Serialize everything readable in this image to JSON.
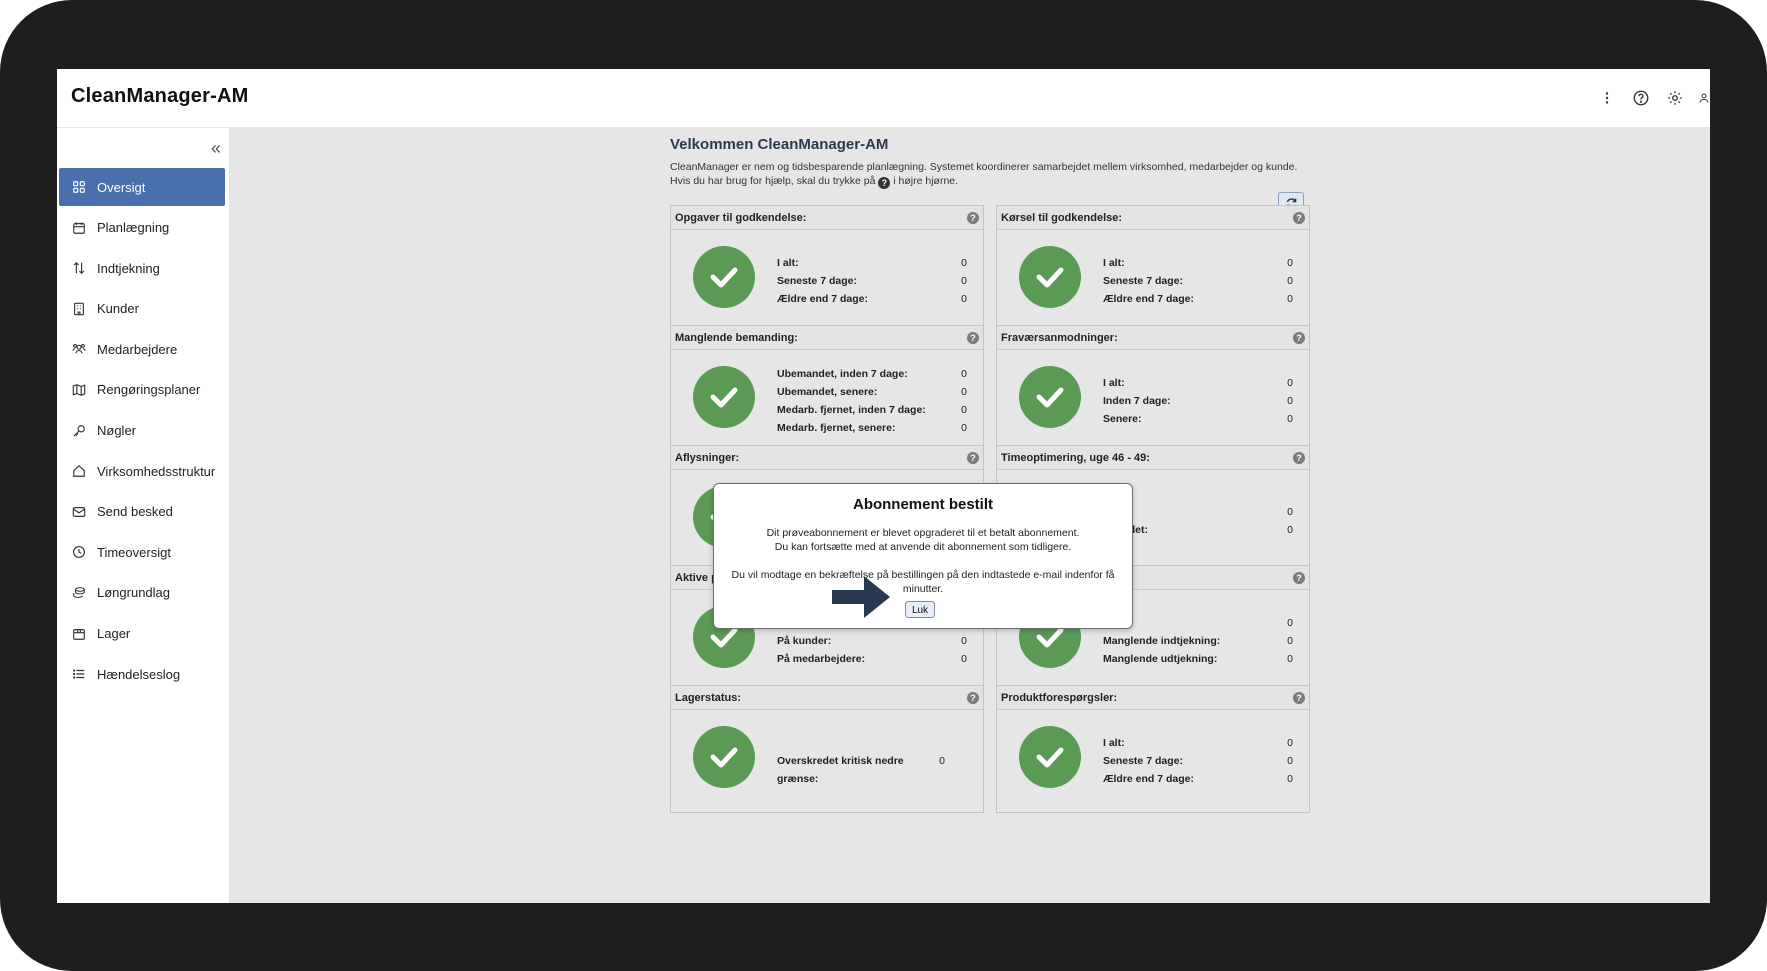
{
  "app": {
    "title": "CleanManager-AM"
  },
  "toolbar": {
    "icons": [
      "more-vertical-icon",
      "help-circle-icon",
      "settings-gear-icon",
      "user-icon"
    ]
  },
  "sidebar": {
    "collapse_label": "«",
    "items": [
      {
        "label": "Oversigt",
        "icon": "grid-icon",
        "active": true
      },
      {
        "label": "Planlægning",
        "icon": "calendar-icon"
      },
      {
        "label": "Indtjekning",
        "icon": "arrows-updown-icon"
      },
      {
        "label": "Kunder",
        "icon": "building-icon"
      },
      {
        "label": "Medarbejdere",
        "icon": "users-icon"
      },
      {
        "label": "Rengøringsplaner",
        "icon": "map-icon"
      },
      {
        "label": "Nøgler",
        "icon": "key-icon"
      },
      {
        "label": "Virksomhedsstruktur",
        "icon": "home-icon"
      },
      {
        "label": "Send besked",
        "icon": "mail-icon"
      },
      {
        "label": "Timeoversigt",
        "icon": "clock-icon"
      },
      {
        "label": "Løngrundlag",
        "icon": "coins-icon"
      },
      {
        "label": "Lager",
        "icon": "box-icon"
      },
      {
        "label": "Hændelseslog",
        "icon": "list-icon"
      }
    ]
  },
  "welcome": {
    "title": "Velkommen CleanManager-AM",
    "line1": "CleanManager er nem og tidsbesparende planlægning. Systemet koordinerer samarbejdet mellem virksomhed, medarbejder og kunde.",
    "line2_before": "Hvis du har brug for hjælp, skal du trykke på",
    "line2_after": "i højre hjørne.",
    "help_glyph": "?"
  },
  "cards": [
    {
      "title": "Opgaver til godkendelse:",
      "rows": [
        [
          "I alt:",
          "0"
        ],
        [
          "Seneste 7 dage:",
          "0"
        ],
        [
          "Ældre end 7 dage:",
          "0"
        ]
      ]
    },
    {
      "title": "Kørsel til godkendelse:",
      "rows": [
        [
          "I alt:",
          "0"
        ],
        [
          "Seneste 7 dage:",
          "0"
        ],
        [
          "Ældre end 7 dage:",
          "0"
        ]
      ]
    },
    {
      "title": "Manglende bemanding:",
      "rows": [
        [
          "Ubemandet, inden 7 dage:",
          "0"
        ],
        [
          "Ubemandet, senere:",
          "0"
        ],
        [
          "Medarb. fjernet, inden 7 dage:",
          "0"
        ],
        [
          "Medarb. fjernet, senere:",
          "0"
        ]
      ]
    },
    {
      "title": "Fraværsanmodninger:",
      "rows": [
        [
          "I alt:",
          "0"
        ],
        [
          "Inden 7 dage:",
          "0"
        ],
        [
          "Senere:",
          "0"
        ]
      ]
    },
    {
      "title": "Aflysninger:",
      "rows": []
    },
    {
      "title": "Timeoptimering, uge 46 - 49:",
      "rows": [
        [
          "ger:",
          "0"
        ],
        [
          "rskredet:",
          "0"
        ]
      ]
    },
    {
      "title": "Aktive påmindelser:",
      "rows": [
        [
          "I alt:",
          "0"
        ],
        [
          "På kunder:",
          "0"
        ],
        [
          "På medarbejdere:",
          "0"
        ]
      ]
    },
    {
      "title": "",
      "rows": [
        [
          "I alt:",
          "0"
        ],
        [
          "Manglende indtjekning:",
          "0"
        ],
        [
          "Manglende udtjekning:",
          "0"
        ]
      ]
    },
    {
      "title": "Lagerstatus:",
      "rows": [
        [
          "Overskredet kritisk nedre grænse:",
          "0"
        ]
      ]
    },
    {
      "title": "Produktforespørgsler:",
      "rows": [
        [
          "I alt:",
          "0"
        ],
        [
          "Seneste 7 dage:",
          "0"
        ],
        [
          "Ældre end 7 dage:",
          "0"
        ]
      ]
    }
  ],
  "help_glyph": "?",
  "modal": {
    "title": "Abonnement bestilt",
    "line1": "Dit prøveabonnement er blevet opgraderet til et betalt abonnement.",
    "line2": "Du kan fortsætte med at anvende dit abonnement som tidligere.",
    "line3": "Du vil modtage en bekræftelse på bestillingen på den indtastede e-mail indenfor få minutter.",
    "close_label": "Luk"
  },
  "colors": {
    "accent": "#4a6fad",
    "check": "#5a9a55",
    "arrow": "#27394f"
  }
}
